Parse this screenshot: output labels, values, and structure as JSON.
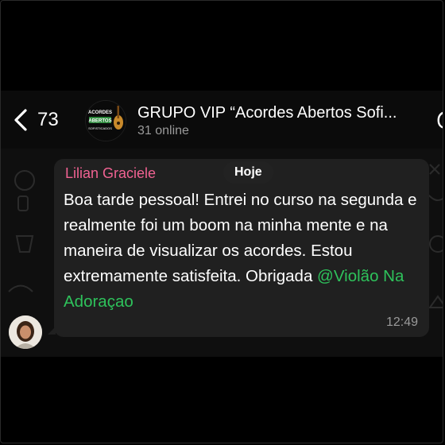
{
  "header": {
    "back_count": "73",
    "group_title": "GRUPO VIP “Acordes Abertos Sofi...",
    "status": "31 online",
    "avatar_logo_lines": [
      "ACORDES",
      "ABERTOS",
      "SOFISTICADOS"
    ]
  },
  "chat": {
    "date_chip": "Hoje",
    "message": {
      "sender": "Lilian Graciele",
      "text": "Boa tarde pessoal! Entrei no curso na segunda e realmente foi um boom na minha mente e na maneira de visualizar os acordes. Estou extremamente satisfeita. Obrigada ",
      "mention": "@Violão Na Adoraçao",
      "time": "12:49"
    }
  },
  "colors": {
    "sender": "#f06292",
    "mention": "#2ec25b",
    "bubble": "#202020",
    "background": "#000000"
  },
  "icons": [
    "back-chevron-icon",
    "call-icon"
  ]
}
